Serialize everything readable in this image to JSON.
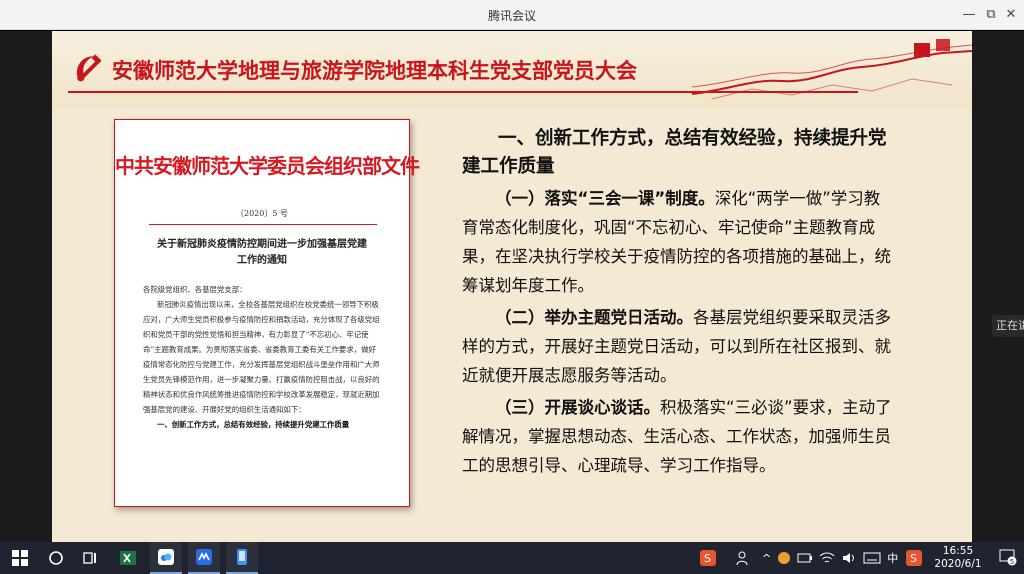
{
  "window": {
    "title": "腾讯会议",
    "minimize": "—",
    "restore": "⧉",
    "close": "✕"
  },
  "side_tab": "正在讲",
  "slide": {
    "title": "安徽师范大学地理与旅游学院地理本科生党支部党员大会",
    "document": {
      "header": "中共安徽师范大学委员会组织部文件",
      "number": "〔2020〕5 号",
      "subject": "关于新冠肺炎疫情防控期间进一步加强基层党建工作的通知",
      "body": [
        "各院级党组织、各基层党支部：",
        "新冠肺炎疫情出现以来，全校各基层党组织在校党委统一领导下积极应对，广大师生党员积极参与疫情防控和捐款活动，充分体现了各级党组织和党员干部的党性觉悟和担当精神，有力彰显了“不忘初心、牢记使命”主题教育成果。为贯彻落实省委、省委教育工委有关工作要求，做好疫情常态化防控与党建工作，充分发挥基层党组织战斗堡垒作用和广大师生党员先锋模范作用，进一步凝聚力量、打赢疫情防控阻击战，以良好的精神状态和优良作风统筹推进疫情防控和学校改革发展稳定，现就近期加强基层党的建设、开展好党的组织生活通知如下："
      ],
      "section": "一、创新工作方式，总结有效经验，持续提升党建工作质量"
    },
    "heading": "一、创新工作方式，总结有效经验，持续提升党建工作质量",
    "paragraphs": [
      {
        "lead": "（一）落实“三会一课”制度。",
        "text": "深化“两学一做”学习教育常态化制度化，巩固“不忘初心、牢记使命”主题教育成果，在坚决执行学校关于疫情防控的各项措施的基础上，统筹谋划年度工作。"
      },
      {
        "lead": "（二）举办主题党日活动。",
        "text": "各基层党组织要采取灵活多样的方式，开展好主题党日活动，可以到所在社区报到、就近就便开展志愿服务等活动。"
      },
      {
        "lead": "（三）开展谈心谈话。",
        "text": "积极落实“三必谈”要求，主动了解情况，掌握思想动态、生活心态、工作状态，加强师生员工的思想引导、心理疏导、学习工作指导。"
      }
    ]
  },
  "taskbar": {
    "ime_lang": "中",
    "ime_badge": "S",
    "time": "16:55",
    "date": "2020/6/1",
    "notifications": "5"
  },
  "colors": {
    "party_red": "#c8141b",
    "slide_bg": "#f4ead3",
    "taskbar_bg": "#1f2430"
  }
}
